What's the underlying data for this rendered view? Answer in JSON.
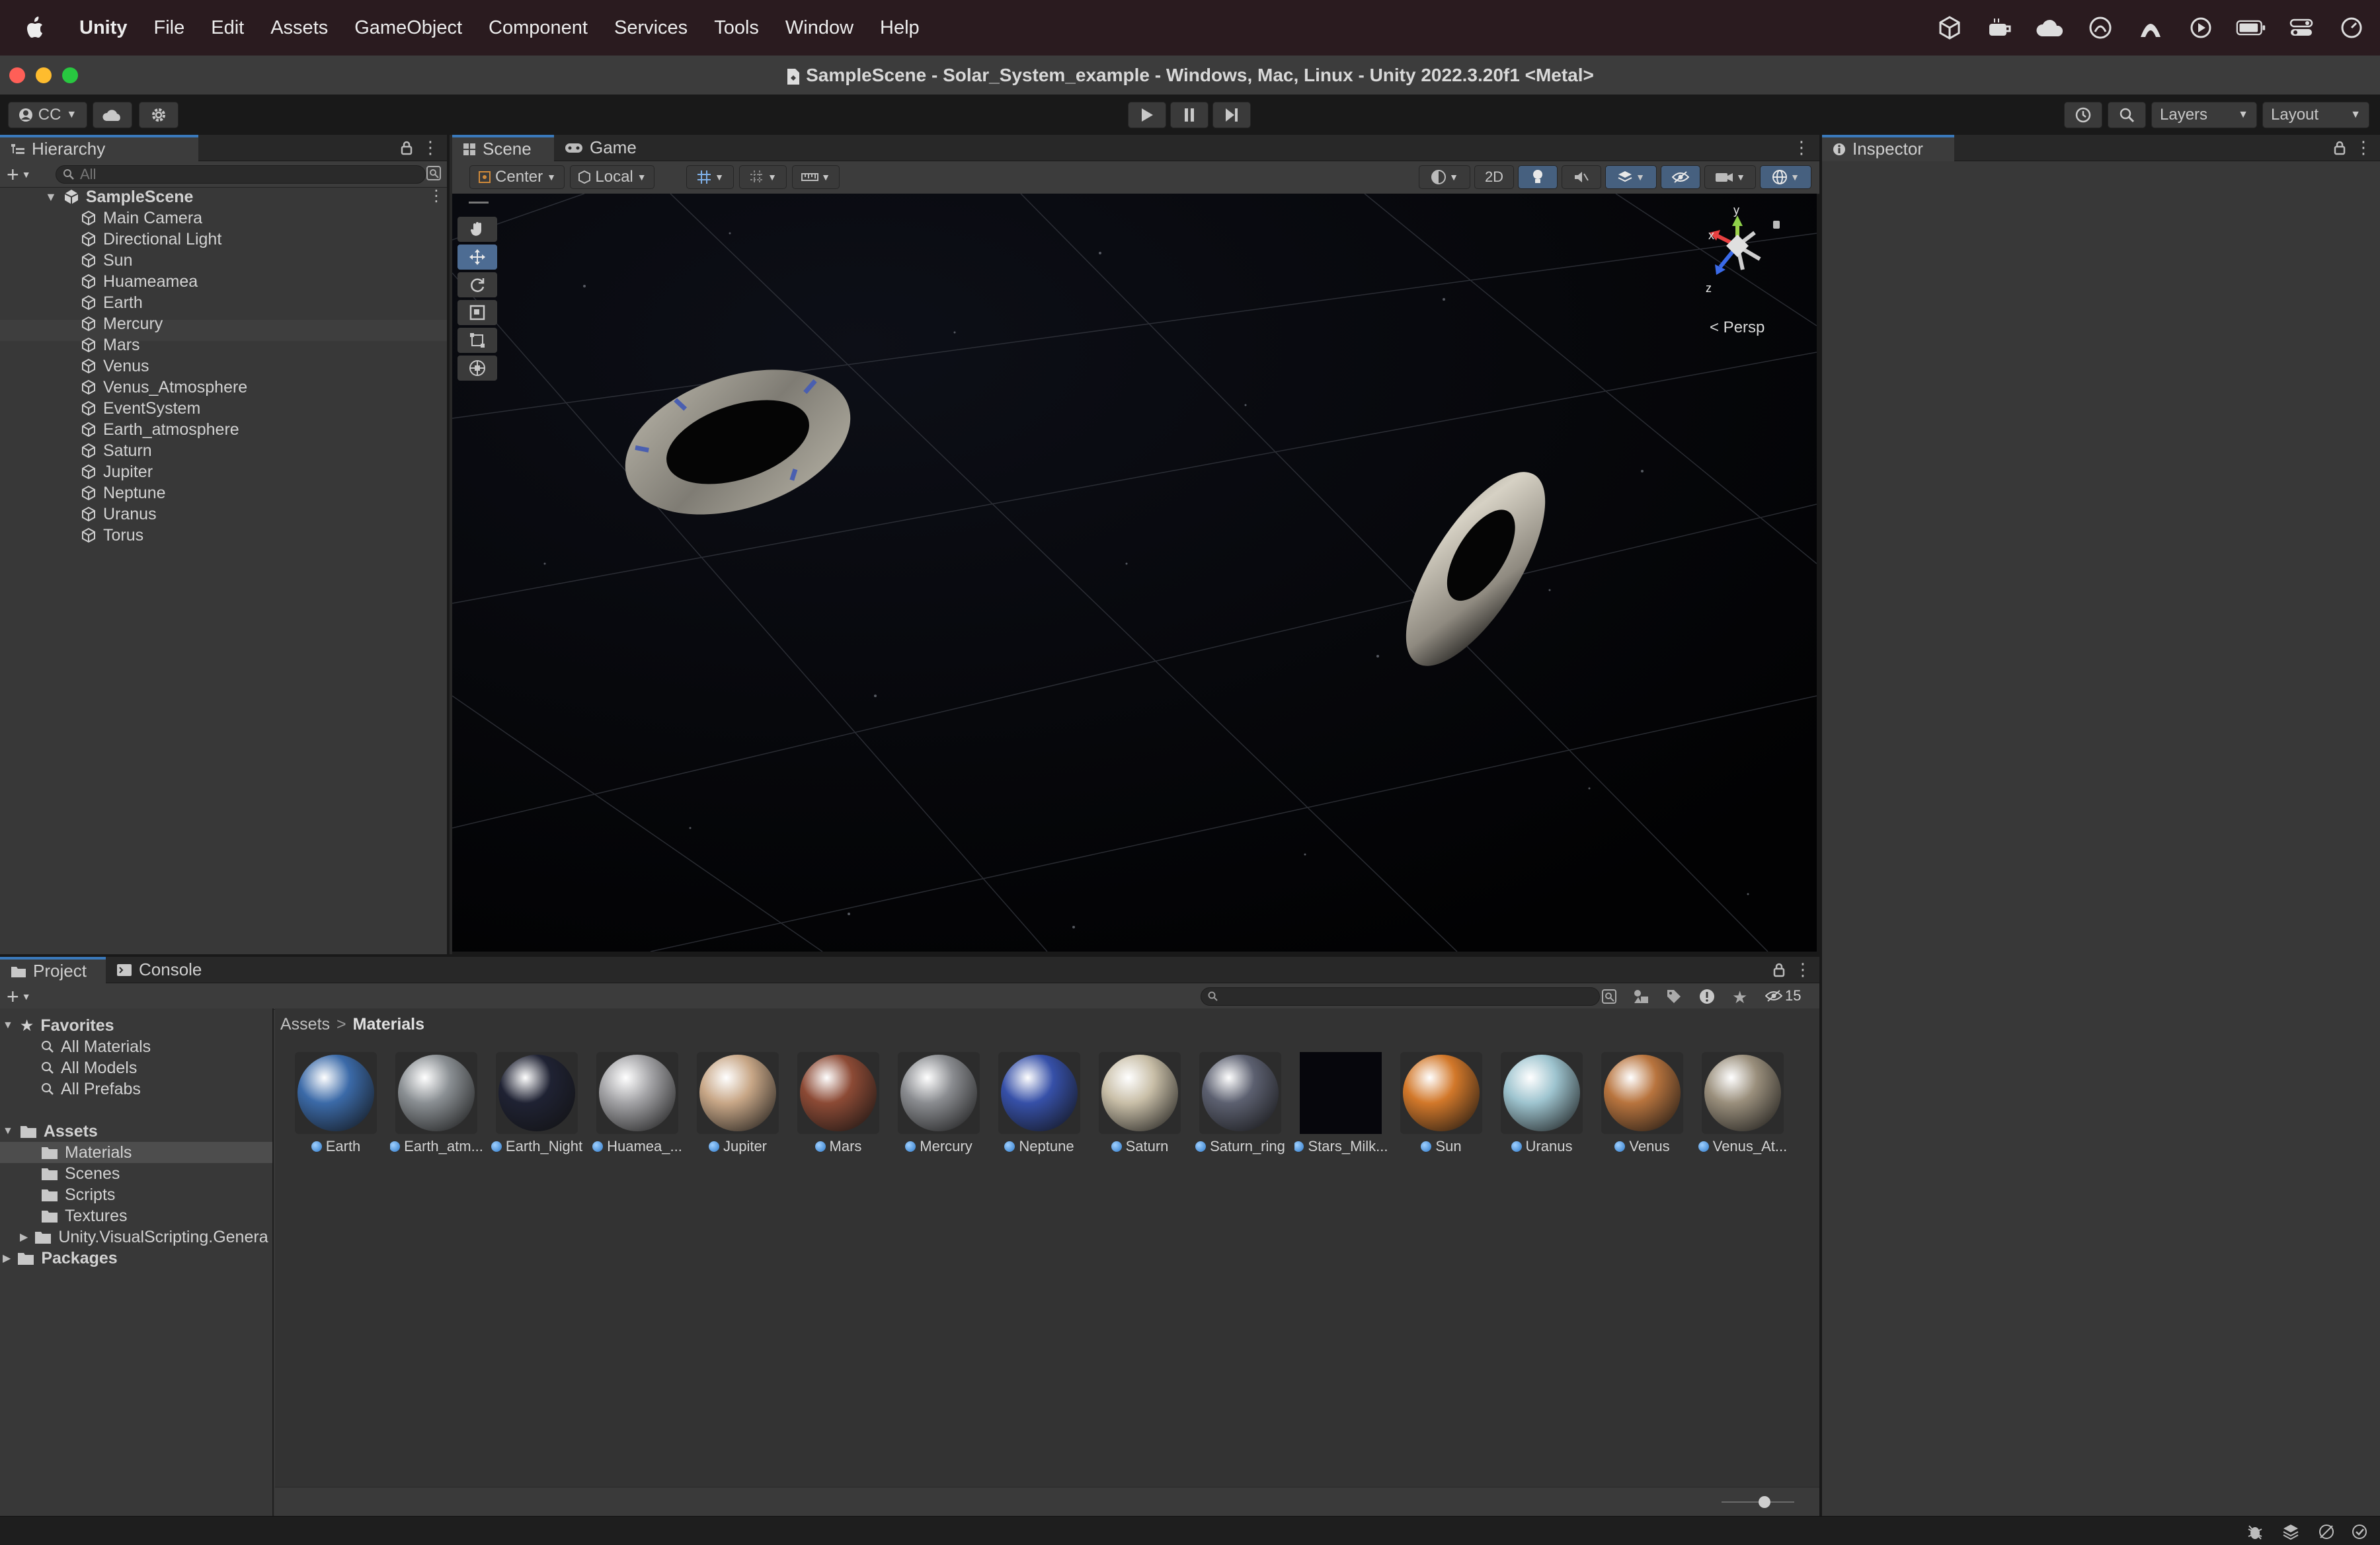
{
  "menubar": {
    "app_name": "Unity",
    "items": [
      "File",
      "Edit",
      "Assets",
      "GameObject",
      "Component",
      "Services",
      "Tools",
      "Window",
      "Help"
    ],
    "status_icons": [
      "unity-hub-icon",
      "coffee-icon",
      "cloud-icon",
      "vpn-icon",
      "arc-icon",
      "play-circle-icon",
      "battery-icon",
      "control-center-icon",
      "clock-icon"
    ]
  },
  "window": {
    "title": "SampleScene - Solar_System_example - Windows, Mac, Linux - Unity 2022.3.20f1 <Metal>"
  },
  "toolbar": {
    "account_label": "CC",
    "layers_label": "Layers",
    "layout_label": "Layout"
  },
  "hierarchy": {
    "tab_label": "Hierarchy",
    "search_placeholder": "All",
    "scene_name": "SampleScene",
    "items": [
      "Main Camera",
      "Directional Light",
      "Sun",
      "Huameamea",
      "Earth",
      "Mercury",
      "Mars",
      "Venus",
      "Venus_Atmosphere",
      "EventSystem",
      "Earth_atmosphere",
      "Saturn",
      "Jupiter",
      "Neptune",
      "Uranus",
      "Torus"
    ]
  },
  "scene": {
    "tabs": [
      "Scene",
      "Game"
    ],
    "pivot_label": "Center",
    "space_label": "Local",
    "mode_2d_label": "2D",
    "persp_label": "< Persp",
    "gizmo_axes": {
      "x": "x",
      "y": "y",
      "z": "z"
    }
  },
  "inspector": {
    "tab_label": "Inspector"
  },
  "project": {
    "tabs": [
      "Project",
      "Console"
    ],
    "favorites_label": "Favorites",
    "favorites": [
      "All Materials",
      "All Models",
      "All Prefabs"
    ],
    "assets_label": "Assets",
    "asset_folders": [
      "Materials",
      "Scenes",
      "Scripts",
      "Textures",
      "Unity.VisualScripting.Genera"
    ],
    "packages_label": "Packages",
    "breadcrumb": {
      "root": "Assets",
      "sep": ">",
      "current": "Materials"
    },
    "hidden_count": "15",
    "materials": [
      {
        "name": "Earth",
        "color": "#3b6aa8"
      },
      {
        "name": "Earth_atm...",
        "color": "#8a8f93"
      },
      {
        "name": "Earth_Night",
        "color": "#1f2233"
      },
      {
        "name": "Huamea_...",
        "color": "#a3a3a6"
      },
      {
        "name": "Jupiter",
        "color": "#c8a787"
      },
      {
        "name": "Mars",
        "color": "#8c4a35"
      },
      {
        "name": "Mercury",
        "color": "#8a8c90"
      },
      {
        "name": "Neptune",
        "color": "#3650a8"
      },
      {
        "name": "Saturn",
        "color": "#c9bfa8"
      },
      {
        "name": "Saturn_ring",
        "color": "#5c6070"
      },
      {
        "name": "Stars_Milk...",
        "color": "#06060c"
      },
      {
        "name": "Sun",
        "color": "#d2782a"
      },
      {
        "name": "Uranus",
        "color": "#9ec4cf"
      },
      {
        "name": "Venus",
        "color": "#b8743e"
      },
      {
        "name": "Venus_At...",
        "color": "#9a8f7c"
      }
    ]
  },
  "colors": {
    "accent": "#3a79bb",
    "menubar_bg": "#2a1b1f",
    "panel_bg": "#383838"
  }
}
